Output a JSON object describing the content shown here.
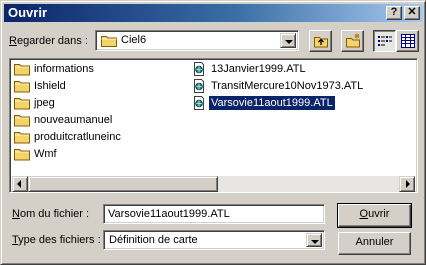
{
  "window": {
    "title": "Ouvrir",
    "help_glyph": "?",
    "close_glyph": "✕"
  },
  "lookin": {
    "label_accel": "R",
    "label_rest": "egarder dans :",
    "value": "Ciel6",
    "icon": "folder-icon"
  },
  "toolbar": {
    "items": [
      "up-folder-icon",
      "new-folder-icon",
      "list-view-icon",
      "details-view-icon"
    ],
    "pressed": "list-view-icon"
  },
  "files": {
    "folders": [
      "informations",
      "Ishield",
      "jpeg",
      "nouveaumanuel",
      "produitcratluneinc",
      "Wmf"
    ],
    "documents": [
      "13Janvier1999.ATL",
      "TransitMercure10Nov1973.ATL",
      "Varsovie11aout1999.ATL"
    ],
    "selected": "Varsovie11aout1999.ATL"
  },
  "filename": {
    "label_accel": "N",
    "label_rest": "om du fichier :",
    "value": "Varsovie11aout1999.ATL"
  },
  "filetype": {
    "label_accel": "T",
    "label_rest": "ype des fichiers :",
    "value": "Définition de carte"
  },
  "buttons": {
    "open_accel": "O",
    "open_rest": "uvrir",
    "cancel": "Annuler"
  },
  "colors": {
    "title_start": "#0a246a",
    "title_end": "#a6caf0",
    "face": "#d4d0c8",
    "selection": "#0a246a",
    "folder": "#f4d46a"
  }
}
